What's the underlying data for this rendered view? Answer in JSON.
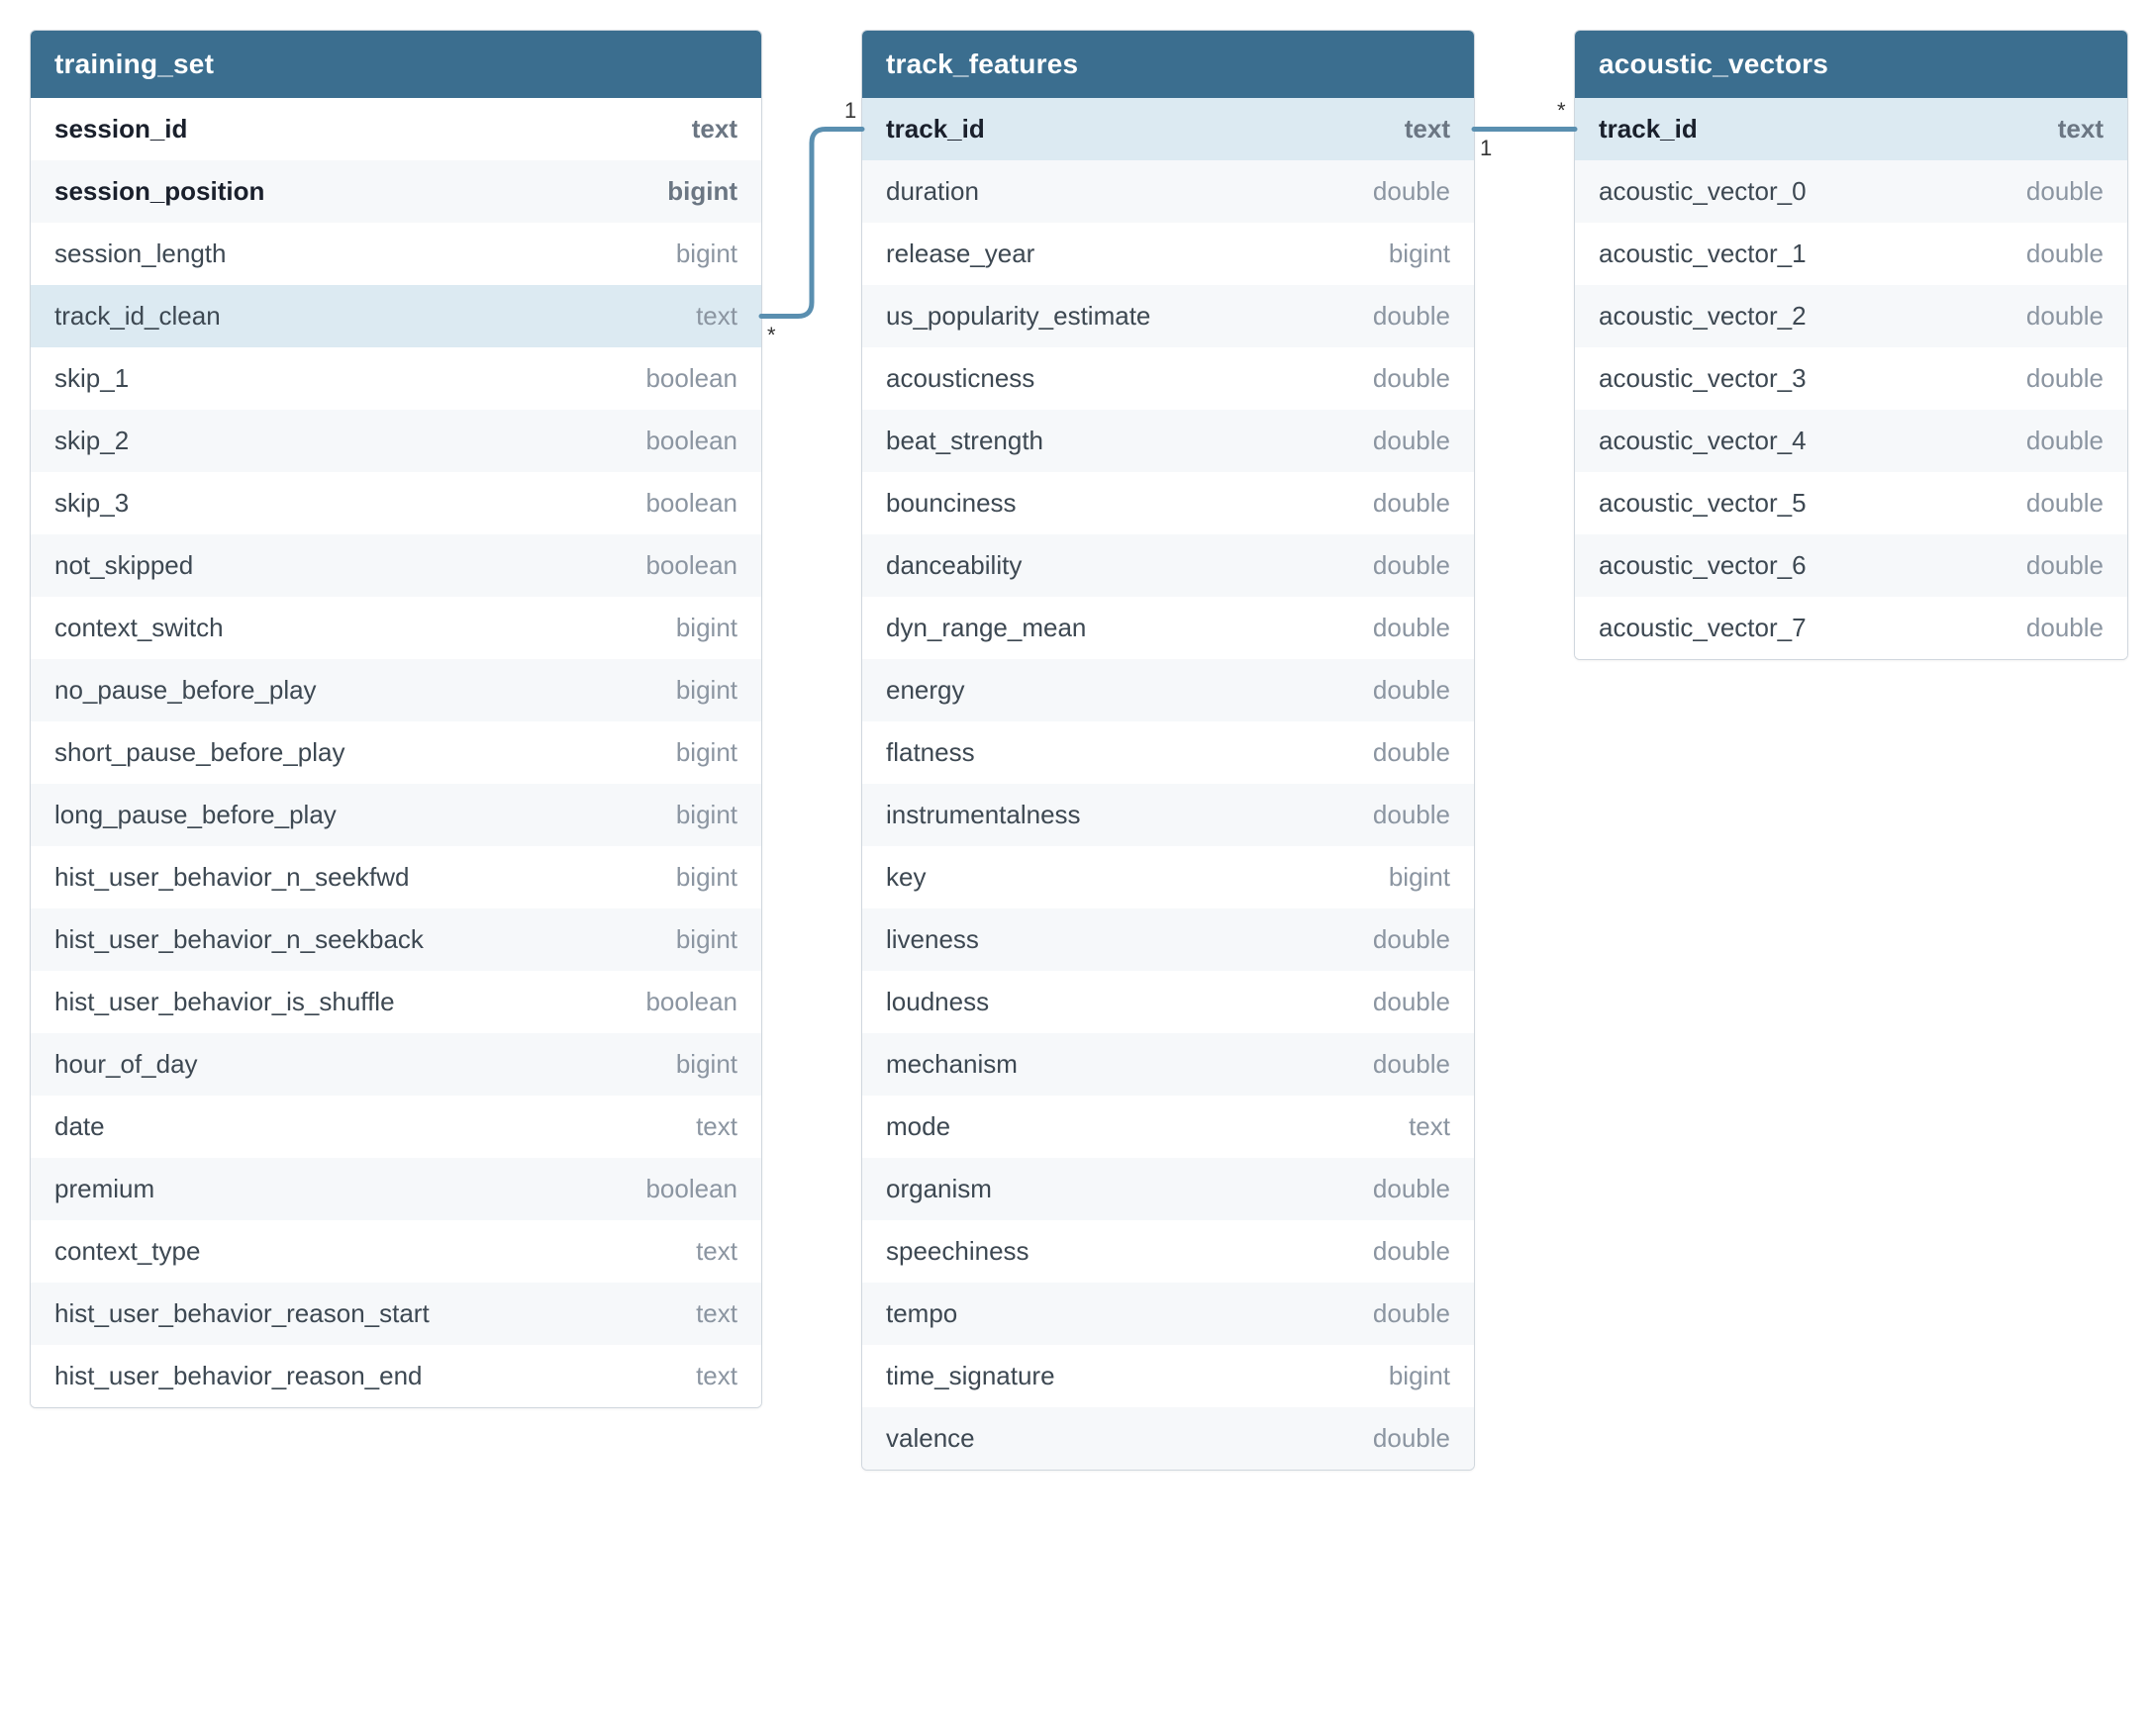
{
  "tables": [
    {
      "name": "training_set",
      "width_class": "w1",
      "columns": [
        {
          "name": "session_id",
          "type": "text",
          "pk": true,
          "hl": false
        },
        {
          "name": "session_position",
          "type": "bigint",
          "pk": true,
          "hl": false
        },
        {
          "name": "session_length",
          "type": "bigint",
          "pk": false,
          "hl": false
        },
        {
          "name": "track_id_clean",
          "type": "text",
          "pk": false,
          "hl": true
        },
        {
          "name": "skip_1",
          "type": "boolean",
          "pk": false,
          "hl": false
        },
        {
          "name": "skip_2",
          "type": "boolean",
          "pk": false,
          "hl": false
        },
        {
          "name": "skip_3",
          "type": "boolean",
          "pk": false,
          "hl": false
        },
        {
          "name": "not_skipped",
          "type": "boolean",
          "pk": false,
          "hl": false
        },
        {
          "name": "context_switch",
          "type": "bigint",
          "pk": false,
          "hl": false
        },
        {
          "name": "no_pause_before_play",
          "type": "bigint",
          "pk": false,
          "hl": false
        },
        {
          "name": "short_pause_before_play",
          "type": "bigint",
          "pk": false,
          "hl": false
        },
        {
          "name": "long_pause_before_play",
          "type": "bigint",
          "pk": false,
          "hl": false
        },
        {
          "name": "hist_user_behavior_n_seekfwd",
          "type": "bigint",
          "pk": false,
          "hl": false
        },
        {
          "name": "hist_user_behavior_n_seekback",
          "type": "bigint",
          "pk": false,
          "hl": false
        },
        {
          "name": "hist_user_behavior_is_shuffle",
          "type": "boolean",
          "pk": false,
          "hl": false
        },
        {
          "name": "hour_of_day",
          "type": "bigint",
          "pk": false,
          "hl": false
        },
        {
          "name": "date",
          "type": "text",
          "pk": false,
          "hl": false
        },
        {
          "name": "premium",
          "type": "boolean",
          "pk": false,
          "hl": false
        },
        {
          "name": "context_type",
          "type": "text",
          "pk": false,
          "hl": false
        },
        {
          "name": "hist_user_behavior_reason_start",
          "type": "text",
          "pk": false,
          "hl": false
        },
        {
          "name": "hist_user_behavior_reason_end",
          "type": "text",
          "pk": false,
          "hl": false
        }
      ]
    },
    {
      "name": "track_features",
      "width_class": "w2",
      "columns": [
        {
          "name": "track_id",
          "type": "text",
          "pk": true,
          "hl": true
        },
        {
          "name": "duration",
          "type": "double",
          "pk": false,
          "hl": false
        },
        {
          "name": "release_year",
          "type": "bigint",
          "pk": false,
          "hl": false
        },
        {
          "name": "us_popularity_estimate",
          "type": "double",
          "pk": false,
          "hl": false
        },
        {
          "name": "acousticness",
          "type": "double",
          "pk": false,
          "hl": false
        },
        {
          "name": "beat_strength",
          "type": "double",
          "pk": false,
          "hl": false
        },
        {
          "name": "bounciness",
          "type": "double",
          "pk": false,
          "hl": false
        },
        {
          "name": "danceability",
          "type": "double",
          "pk": false,
          "hl": false
        },
        {
          "name": "dyn_range_mean",
          "type": "double",
          "pk": false,
          "hl": false
        },
        {
          "name": "energy",
          "type": "double",
          "pk": false,
          "hl": false
        },
        {
          "name": "flatness",
          "type": "double",
          "pk": false,
          "hl": false
        },
        {
          "name": "instrumentalness",
          "type": "double",
          "pk": false,
          "hl": false
        },
        {
          "name": "key",
          "type": "bigint",
          "pk": false,
          "hl": false
        },
        {
          "name": "liveness",
          "type": "double",
          "pk": false,
          "hl": false
        },
        {
          "name": "loudness",
          "type": "double",
          "pk": false,
          "hl": false
        },
        {
          "name": "mechanism",
          "type": "double",
          "pk": false,
          "hl": false
        },
        {
          "name": "mode",
          "type": "text",
          "pk": false,
          "hl": false
        },
        {
          "name": "organism",
          "type": "double",
          "pk": false,
          "hl": false
        },
        {
          "name": "speechiness",
          "type": "double",
          "pk": false,
          "hl": false
        },
        {
          "name": "tempo",
          "type": "double",
          "pk": false,
          "hl": false
        },
        {
          "name": "time_signature",
          "type": "bigint",
          "pk": false,
          "hl": false
        },
        {
          "name": "valence",
          "type": "double",
          "pk": false,
          "hl": false
        }
      ]
    },
    {
      "name": "acoustic_vectors",
      "width_class": "w3",
      "columns": [
        {
          "name": "track_id",
          "type": "text",
          "pk": true,
          "hl": true
        },
        {
          "name": "acoustic_vector_0",
          "type": "double",
          "pk": false,
          "hl": false
        },
        {
          "name": "acoustic_vector_1",
          "type": "double",
          "pk": false,
          "hl": false
        },
        {
          "name": "acoustic_vector_2",
          "type": "double",
          "pk": false,
          "hl": false
        },
        {
          "name": "acoustic_vector_3",
          "type": "double",
          "pk": false,
          "hl": false
        },
        {
          "name": "acoustic_vector_4",
          "type": "double",
          "pk": false,
          "hl": false
        },
        {
          "name": "acoustic_vector_5",
          "type": "double",
          "pk": false,
          "hl": false
        },
        {
          "name": "acoustic_vector_6",
          "type": "double",
          "pk": false,
          "hl": false
        },
        {
          "name": "acoustic_vector_7",
          "type": "double",
          "pk": false,
          "hl": false
        }
      ]
    }
  ],
  "relations": [
    {
      "from_table": 0,
      "from_col": 3,
      "to_table": 1,
      "to_col": 0,
      "left_card": "*",
      "right_card": "1"
    },
    {
      "from_table": 1,
      "from_col": 0,
      "to_table": 2,
      "to_col": 0,
      "left_card": "1",
      "right_card": "*"
    }
  ],
  "colors": {
    "header_bg": "#3b6e8f",
    "connector": "#5a8fb0",
    "highlight": "#dceaf2"
  }
}
